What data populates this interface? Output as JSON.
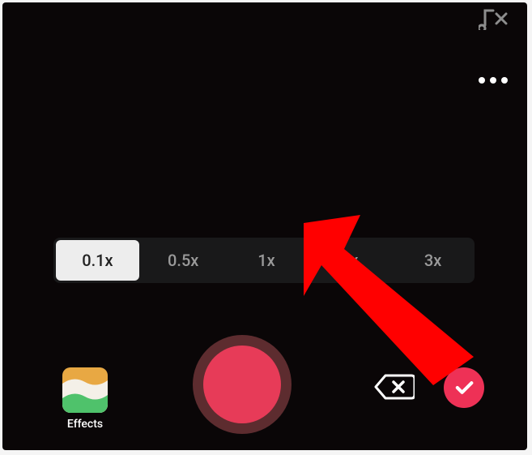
{
  "speed_options": {
    "opt0": "0.1x",
    "opt1": "0.5x",
    "opt2": "1x",
    "opt3": "2x",
    "opt4": "3x",
    "active_index": 0
  },
  "effects": {
    "label": "Effects"
  },
  "colors": {
    "confirm": "#ee3156",
    "record": "#e73b58",
    "record_ring": "#5d2c2f",
    "arrow": "#ff0000",
    "bg": "#0a0607"
  },
  "icons": {
    "sound_cut": "sound-cut-icon",
    "more": "more-menu-icon",
    "delete": "delete-clip-icon",
    "confirm": "checkmark-icon",
    "record": "record-icon"
  }
}
